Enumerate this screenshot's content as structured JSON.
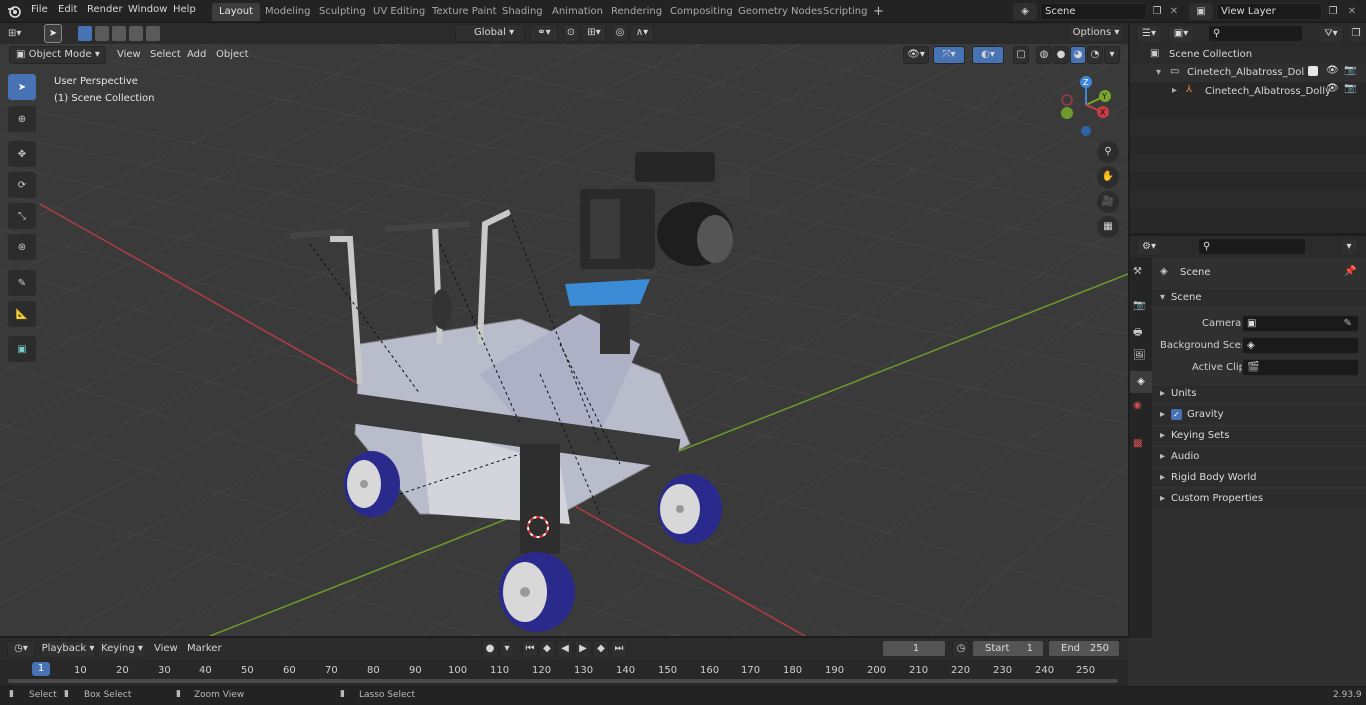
{
  "menu": {
    "file": "File",
    "edit": "Edit",
    "render": "Render",
    "window": "Window",
    "help": "Help"
  },
  "workspaces": [
    "Layout",
    "Modeling",
    "Sculpting",
    "UV Editing",
    "Texture Paint",
    "Shading",
    "Animation",
    "Rendering",
    "Compositing",
    "Geometry Nodes",
    "Scripting"
  ],
  "scene_field": "Scene",
  "view_layer_field": "View Layer",
  "header": {
    "transform_orientation": "Global",
    "options": "Options"
  },
  "viewport_header": {
    "mode": "Object Mode",
    "view": "View",
    "select": "Select",
    "add": "Add",
    "object": "Object"
  },
  "viewport": {
    "perspective": "User Perspective",
    "collection": "(1) Scene Collection"
  },
  "gizmo": {
    "z": "Z",
    "y": "Y",
    "x": "X"
  },
  "outliner": {
    "scene_collection": "Scene Collection",
    "item1": "Cinetech_Albatross_Dolly_with",
    "item2": "Cinetech_Albatross_Dolly"
  },
  "properties": {
    "scene_title": "Scene",
    "panel_scene": "Scene",
    "camera_label": "Camera",
    "background_label": "Background Scene",
    "active_clip_label": "Active Clip",
    "panels": [
      "Units",
      "Gravity",
      "Keying Sets",
      "Audio",
      "Rigid Body World",
      "Custom Properties"
    ]
  },
  "timeline": {
    "playback": "Playback",
    "keying": "Keying",
    "view": "View",
    "marker": "Marker",
    "current_frame": "1",
    "start_label": "Start",
    "start": "1",
    "end_label": "End",
    "end": "250",
    "ruler": [
      "1",
      "10",
      "20",
      "30",
      "40",
      "50",
      "60",
      "70",
      "80",
      "90",
      "100",
      "110",
      "120",
      "130",
      "140",
      "150",
      "160",
      "170",
      "180",
      "190",
      "200",
      "210",
      "220",
      "230",
      "240",
      "250"
    ]
  },
  "status": {
    "select": "Select",
    "box_select": "Box Select",
    "zoom_view": "Zoom View",
    "lasso_select": "Lasso Select",
    "version": "2.93.9"
  },
  "colors": {
    "accent": "#4772b3",
    "x_axis": "#c93b45",
    "y_axis": "#7aa52a",
    "z_axis": "#3d86d8",
    "grid_bg": "#3a3a3a"
  }
}
